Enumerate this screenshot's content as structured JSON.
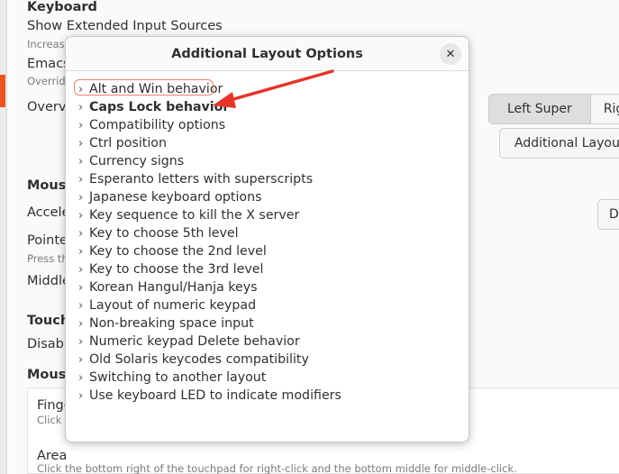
{
  "background": {
    "keyboard_heading": "Keyboard",
    "show_extended_label": "Show Extended Input Sources",
    "increase_text": "Increase",
    "emacs_label": "Emacs",
    "override_text": "Overrid",
    "overview_label": "Overvi",
    "left_super_button": "Left Super",
    "right_button_partial": "Rig",
    "additional_layout_button": "Additional Layout",
    "mouse_heading": "Mouse",
    "acceleration_label": "Accele",
    "d_button_partial": "De",
    "pointer_label": "Pointe",
    "press_text": "Press th",
    "middle_label": "Middle",
    "touchpad_heading": "Touch",
    "disable_label": "Disabl",
    "mouse_click_heading": "Mouse",
    "finger_label": "Finge",
    "click_text": "Click b",
    "area_label": "Area",
    "area_desc": "Click the bottom right of the touchpad for right-click and the bottom middle for middle-click."
  },
  "dialog": {
    "title": "Additional Layout Options",
    "close_icon": "✕",
    "options": [
      {
        "label": "Alt and Win behavior"
      },
      {
        "label": "Caps Lock behavior"
      },
      {
        "label": "Compatibility options"
      },
      {
        "label": "Ctrl position"
      },
      {
        "label": "Currency signs"
      },
      {
        "label": "Esperanto letters with superscripts"
      },
      {
        "label": "Japanese keyboard options"
      },
      {
        "label": "Key sequence to kill the X server"
      },
      {
        "label": "Key to choose 5th level"
      },
      {
        "label": "Key to choose the 2nd level"
      },
      {
        "label": "Key to choose the 3rd level"
      },
      {
        "label": "Korean Hangul/Hanja keys"
      },
      {
        "label": "Layout of numeric keypad"
      },
      {
        "label": "Non-breaking space input"
      },
      {
        "label": "Numeric keypad Delete behavior"
      },
      {
        "label": "Old Solaris keycodes compatibility"
      },
      {
        "label": "Switching to another layout"
      },
      {
        "label": "Use keyboard LED to indicate modifiers"
      }
    ],
    "chevron_glyph": "›"
  },
  "annotation": {
    "highlight_color": "#e8846a",
    "arrow_color": "#e5352b"
  },
  "colors": {
    "accent": "#e95420"
  }
}
